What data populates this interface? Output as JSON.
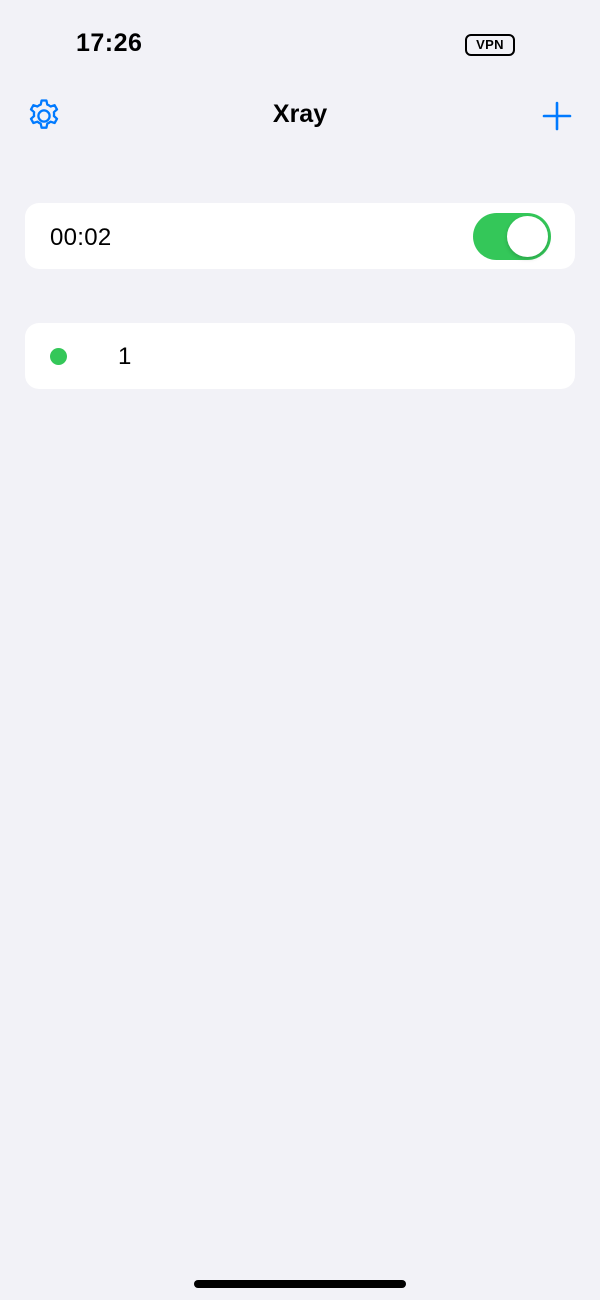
{
  "status_bar": {
    "time": "17:26",
    "vpn_label": "VPN"
  },
  "nav": {
    "title": "Xray",
    "settings_icon": "gear-icon",
    "add_icon": "plus-icon",
    "accent_color": "#007AFF"
  },
  "connection": {
    "elapsed": "00:02",
    "toggle_on": true,
    "toggle_color": "#34C759"
  },
  "configs": [
    {
      "name": "1",
      "status_color": "#34C759",
      "active": true
    }
  ],
  "theme": {
    "background": "#F2F2F7",
    "card_background": "#FFFFFF"
  }
}
